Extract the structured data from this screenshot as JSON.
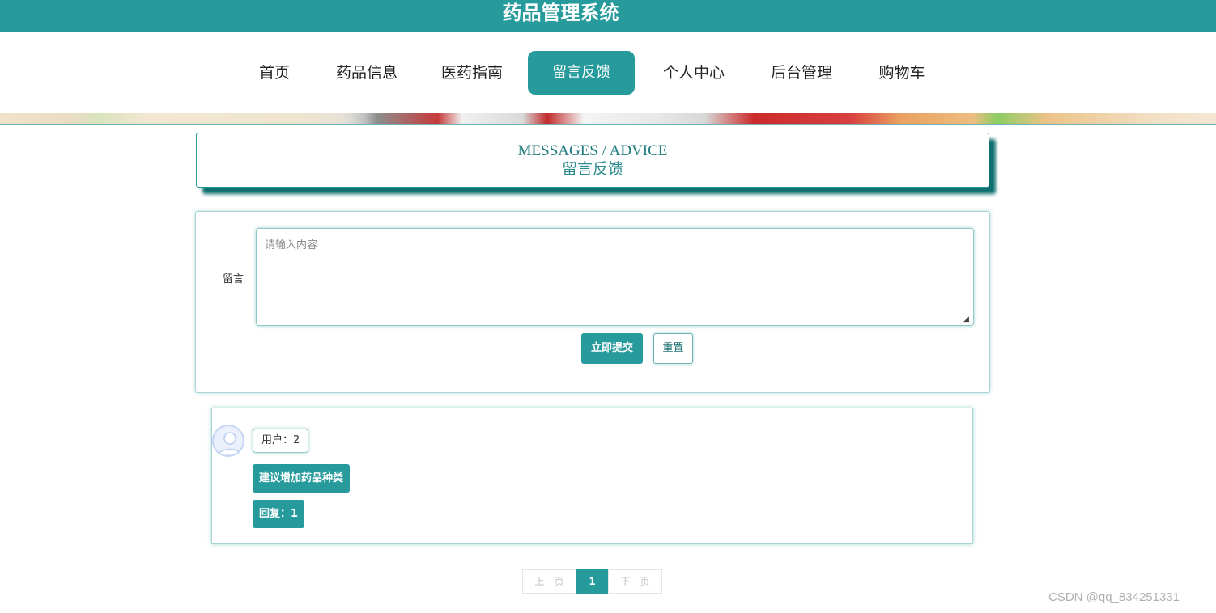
{
  "header": {
    "title": "药品管理系统"
  },
  "nav": {
    "items": [
      {
        "label": "首页"
      },
      {
        "label": "药品信息"
      },
      {
        "label": "医药指南"
      },
      {
        "label": "留言反馈",
        "active": true
      },
      {
        "label": "个人中心"
      },
      {
        "label": "后台管理"
      },
      {
        "label": "购物车"
      }
    ]
  },
  "section": {
    "title_en": "MESSAGES / ADVICE",
    "title_cn": "留言反馈"
  },
  "form": {
    "label": "留言",
    "placeholder": "请输入内容",
    "value": "",
    "submit_label": "立即提交",
    "reset_label": "重置"
  },
  "comments": [
    {
      "user": "用户：2",
      "content": "建议增加药品种类",
      "reply": "回复：1"
    }
  ],
  "pagination": {
    "prev_label": "上一页",
    "current": "1",
    "next_label": "下一页"
  },
  "watermark": "CSDN @qq_834251331",
  "colors": {
    "accent": "#279a9c",
    "dark_accent": "#0f6e70"
  },
  "icons": {
    "avatar": "user-avatar-icon"
  }
}
